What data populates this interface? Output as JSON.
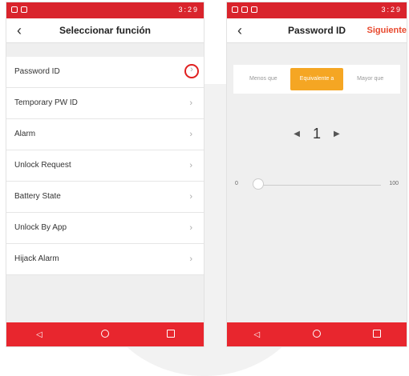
{
  "colors": {
    "brand_red": "#d9242c",
    "accent_orange": "#f5a623",
    "siguiente_orange": "#e8492e",
    "highlight_circle": "#e02020"
  },
  "left_screen": {
    "title": "Seleccionar función",
    "back_icon": "arrow-left-icon",
    "items": [
      {
        "label": "Password ID",
        "highlighted": true
      },
      {
        "label": "Temporary PW ID"
      },
      {
        "label": "Alarm"
      },
      {
        "label": "Unlock Request"
      },
      {
        "label": "Battery State"
      },
      {
        "label": "Unlock By App"
      },
      {
        "label": "Hijack Alarm"
      }
    ]
  },
  "right_screen": {
    "title": "Password ID",
    "action_label": "Siguiente",
    "segments": [
      {
        "label": "Menos que",
        "selected": false
      },
      {
        "label": "Equivalente a",
        "selected": true
      },
      {
        "label": "Mayor que",
        "selected": false
      }
    ],
    "stepper_value": "1",
    "slider": {
      "min_label": "0",
      "max_label": "100",
      "value": 0
    }
  },
  "status_bar": {
    "time": "3:29"
  },
  "nav_bar": {
    "icons": [
      "back-triangle-icon",
      "home-circle-icon",
      "recent-square-icon"
    ]
  }
}
